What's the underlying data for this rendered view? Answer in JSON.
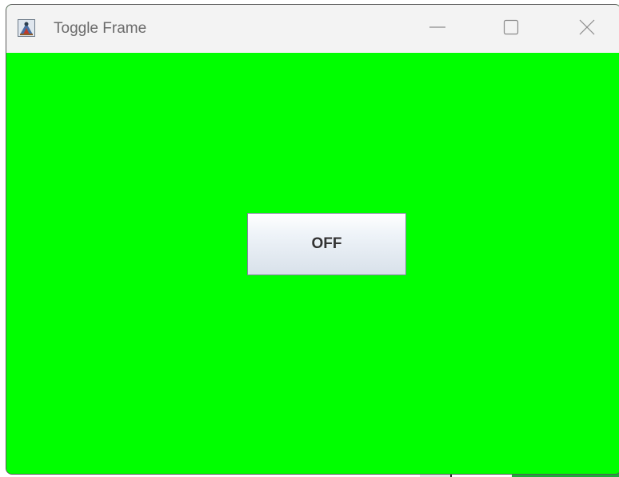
{
  "window": {
    "title": "Toggle Frame",
    "icon": "java-app-icon",
    "controls": {
      "minimize": "minimize-icon",
      "maximize": "maximize-icon",
      "close": "close-icon"
    }
  },
  "content": {
    "background_color": "#00ff00",
    "toggle_button": {
      "label": "OFF",
      "state": "off"
    }
  }
}
